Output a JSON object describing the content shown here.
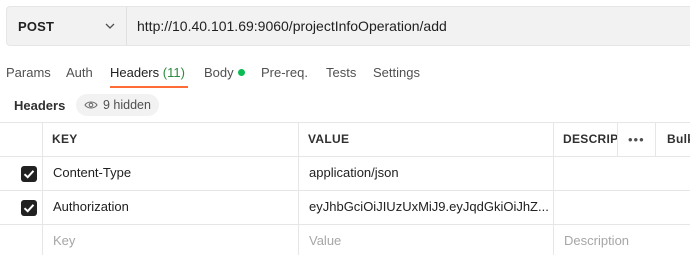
{
  "request": {
    "method": "POST",
    "url": "http://10.40.101.69:9060/projectInfoOperation/add"
  },
  "tabs": [
    {
      "label": "Params"
    },
    {
      "label": "Auth"
    },
    {
      "label": "Headers",
      "count": "(11)",
      "active": true
    },
    {
      "label": "Body",
      "indicator_color": "#0cbb52"
    },
    {
      "label": "Pre-req."
    },
    {
      "label": "Tests"
    },
    {
      "label": "Settings"
    }
  ],
  "headers_section": {
    "title": "Headers",
    "hidden_label": "9 hidden"
  },
  "table": {
    "columns": [
      "KEY",
      "VALUE",
      "DESCRIPTI",
      "Bulk"
    ],
    "more_label": "•••",
    "rows": [
      {
        "checked": true,
        "key": "Content-Type",
        "value": "application/json",
        "description": ""
      },
      {
        "checked": true,
        "key": "Authorization",
        "value": "eyJhbGciOiJIUzUxMiJ9.eyJqdGkiOiJhZ...",
        "description": ""
      }
    ],
    "placeholders": {
      "key": "Key",
      "value": "Value",
      "description": "Description"
    }
  },
  "colors": {
    "accent": "#ff6c37",
    "count": "#2b8a3e",
    "body_dot": "#0cbb52"
  }
}
